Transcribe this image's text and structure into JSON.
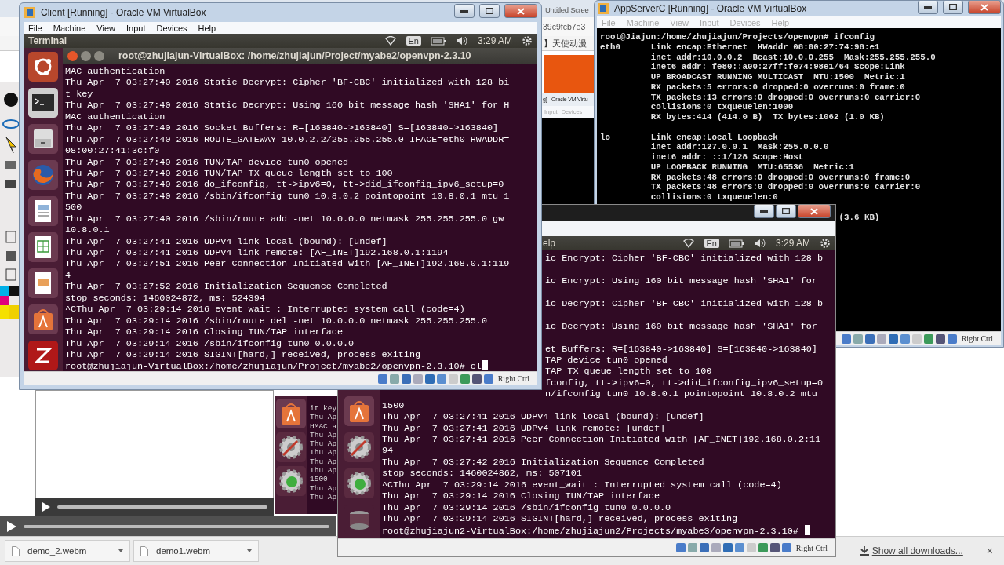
{
  "browser": {
    "tab_title": "Untitled Scree",
    "address": "39c9fcb7e3",
    "bookmark": "】天使动漫"
  },
  "fragment_window": {
    "title": "g] - Oracle VM Virtu",
    "menu": [
      "Input",
      "Devices"
    ]
  },
  "client": {
    "title": "Client [Running] - Oracle VM VirtualBox",
    "menu": [
      "File",
      "Machine",
      "View",
      "Input",
      "Devices",
      "Help"
    ],
    "panel": {
      "app": "Terminal",
      "lang": "En",
      "time": "3:29 AM"
    },
    "terminal": {
      "title": "root@zhujiajun-VirtualBox: /home/zhujiajun/Project/myabe2/openvpn-2.3.10",
      "lines": [
        "MAC authentication",
        "Thu Apr  7 03:27:40 2016 Static Decrypt: Cipher 'BF-CBC' initialized with 128 bi",
        "t key",
        "Thu Apr  7 03:27:40 2016 Static Decrypt: Using 160 bit message hash 'SHA1' for H",
        "MAC authentication",
        "Thu Apr  7 03:27:40 2016 Socket Buffers: R=[163840->163840] S=[163840->163840]",
        "Thu Apr  7 03:27:40 2016 ROUTE_GATEWAY 10.0.2.2/255.255.255.0 IFACE=eth0 HWADDR=",
        "08:00:27:41:3c:f0",
        "Thu Apr  7 03:27:40 2016 TUN/TAP device tun0 opened",
        "Thu Apr  7 03:27:40 2016 TUN/TAP TX queue length set to 100",
        "Thu Apr  7 03:27:40 2016 do_ifconfig, tt->ipv6=0, tt->did_ifconfig_ipv6_setup=0",
        "Thu Apr  7 03:27:40 2016 /sbin/ifconfig tun0 10.8.0.2 pointopoint 10.8.0.1 mtu 1",
        "500",
        "Thu Apr  7 03:27:40 2016 /sbin/route add -net 10.0.0.0 netmask 255.255.255.0 gw",
        "10.8.0.1",
        "Thu Apr  7 03:27:41 2016 UDPv4 link local (bound): [undef]",
        "Thu Apr  7 03:27:41 2016 UDPv4 link remote: [AF_INET]192.168.0.1:1194",
        "Thu Apr  7 03:27:51 2016 Peer Connection Initiated with [AF_INET]192.168.0.1:119",
        "4",
        "Thu Apr  7 03:27:52 2016 Initialization Sequence Completed",
        "stop seconds: 1460024872, ms: 524394",
        "^CThu Apr  7 03:29:14 2016 event_wait : Interrupted system call (code=4)",
        "Thu Apr  7 03:29:14 2016 /sbin/route del -net 10.0.0.0 netmask 255.255.255.0",
        "Thu Apr  7 03:29:14 2016 Closing TUN/TAP interface",
        "Thu Apr  7 03:29:14 2016 /sbin/ifconfig tun0 0.0.0.0",
        "Thu Apr  7 03:29:14 2016 SIGINT[hard,] received, process exiting",
        "root@zhujiajun-VirtualBox:/home/zhujiajun/Project/myabe2/openvpn-2.3.10# cl"
      ]
    },
    "status": "Right Ctrl"
  },
  "app_server": {
    "title": "AppServerC [Running] - Oracle VM VirtualBox",
    "menu": [
      "File",
      "Machine",
      "View",
      "Input",
      "Devices",
      "Help"
    ],
    "blocks": [
      [
        "root@Jiajun:/home/zhujiajun/Projects/openvpn# ifconfig",
        "eth0      Link encap:Ethernet  HWaddr 08:00:27:74:98:e1",
        "          inet addr:10.0.0.2  Bcast:10.0.0.255  Mask:255.255.255.0",
        "          inet6 addr: fe80::a00:27ff:fe74:98e1/64 Scope:Link",
        "          UP BROADCAST RUNNING MULTICAST  MTU:1500  Metric:1",
        "          RX packets:5 errors:0 dropped:0 overruns:0 frame:0",
        "          TX packets:13 errors:0 dropped:0 overruns:0 carrier:0",
        "          collisions:0 txqueuelen:1000",
        "          RX bytes:414 (414.0 B)  TX bytes:1062 (1.0 KB)"
      ],
      [
        "lo        Link encap:Local Loopback",
        "          inet addr:127.0.0.1  Mask:255.0.0.0",
        "          inet6 addr: ::1/128 Scope:Host",
        "          UP LOOPBACK RUNNING  MTU:65536  Metric:1",
        "          RX packets:48 errors:0 dropped:0 overruns:0 frame:0",
        "          TX packets:48 errors:0 dropped:0 overruns:0 carrier:0",
        "          collisions:0 txqueuelen:0"
      ]
    ],
    "covered_tail": "(3.6 KB)",
    "status": "Right Ctrl"
  },
  "back_terminal": {
    "lines": [
      "it key",
      "Thu Ap",
      "HMAC a",
      "Thu Ap",
      "Thu Ap",
      "Thu Ap",
      "Thu Ap",
      "Thu Ap",
      "1500",
      "Thu Ap",
      "Thu Ap"
    ]
  },
  "server": {
    "panel": {
      "menu_fragment": "elp",
      "lang": "En",
      "time": "3:29 AM"
    },
    "upper_blocks": [
      [
        "ic Encrypt: Cipher 'BF-CBC' initialized with 128 b"
      ],
      [
        "ic Encrypt: Using 160 bit message hash 'SHA1' for"
      ],
      [
        "ic Decrypt: Cipher 'BF-CBC' initialized with 128 b"
      ],
      [
        "ic Decrypt: Using 160 bit message hash 'SHA1' for"
      ],
      [
        "et Buffers: R=[163840->163840] S=[163840->163840]",
        "TAP device tun0 opened",
        "TAP TX queue length set to 100",
        "fconfig, tt->ipv6=0, tt->did_ifconfig_ipv6_setup=0",
        "n/ifconfig tun0 10.8.0.1 pointopoint 10.8.0.2 mtu"
      ]
    ],
    "lower_lines": [
      "1500",
      "Thu Apr  7 03:27:41 2016 UDPv4 link local (bound): [undef]",
      "Thu Apr  7 03:27:41 2016 UDPv4 link remote: [undef]",
      "Thu Apr  7 03:27:41 2016 Peer Connection Initiated with [AF_INET]192.168.0.2:11",
      "94",
      "Thu Apr  7 03:27:42 2016 Initialization Sequence Completed",
      "stop seconds: 1460024862, ms: 507101",
      "^CThu Apr  7 03:29:14 2016 event_wait : Interrupted system call (code=4)",
      "Thu Apr  7 03:29:14 2016 Closing TUN/TAP interface",
      "Thu Apr  7 03:29:14 2016 /sbin/ifconfig tun0 0.0.0.0",
      "Thu Apr  7 03:29:14 2016 SIGINT[hard,] received, process exiting",
      "root@zhujiajun2-VirtualBox:/home/zhujiajun2/Projects/myabe3/openvpn-2.3.10#"
    ],
    "status": "Right Ctrl"
  },
  "downloads": {
    "files": [
      "demo_2.webm",
      "demo1.webm"
    ],
    "show_all": "Show all downloads...",
    "close": "×"
  }
}
